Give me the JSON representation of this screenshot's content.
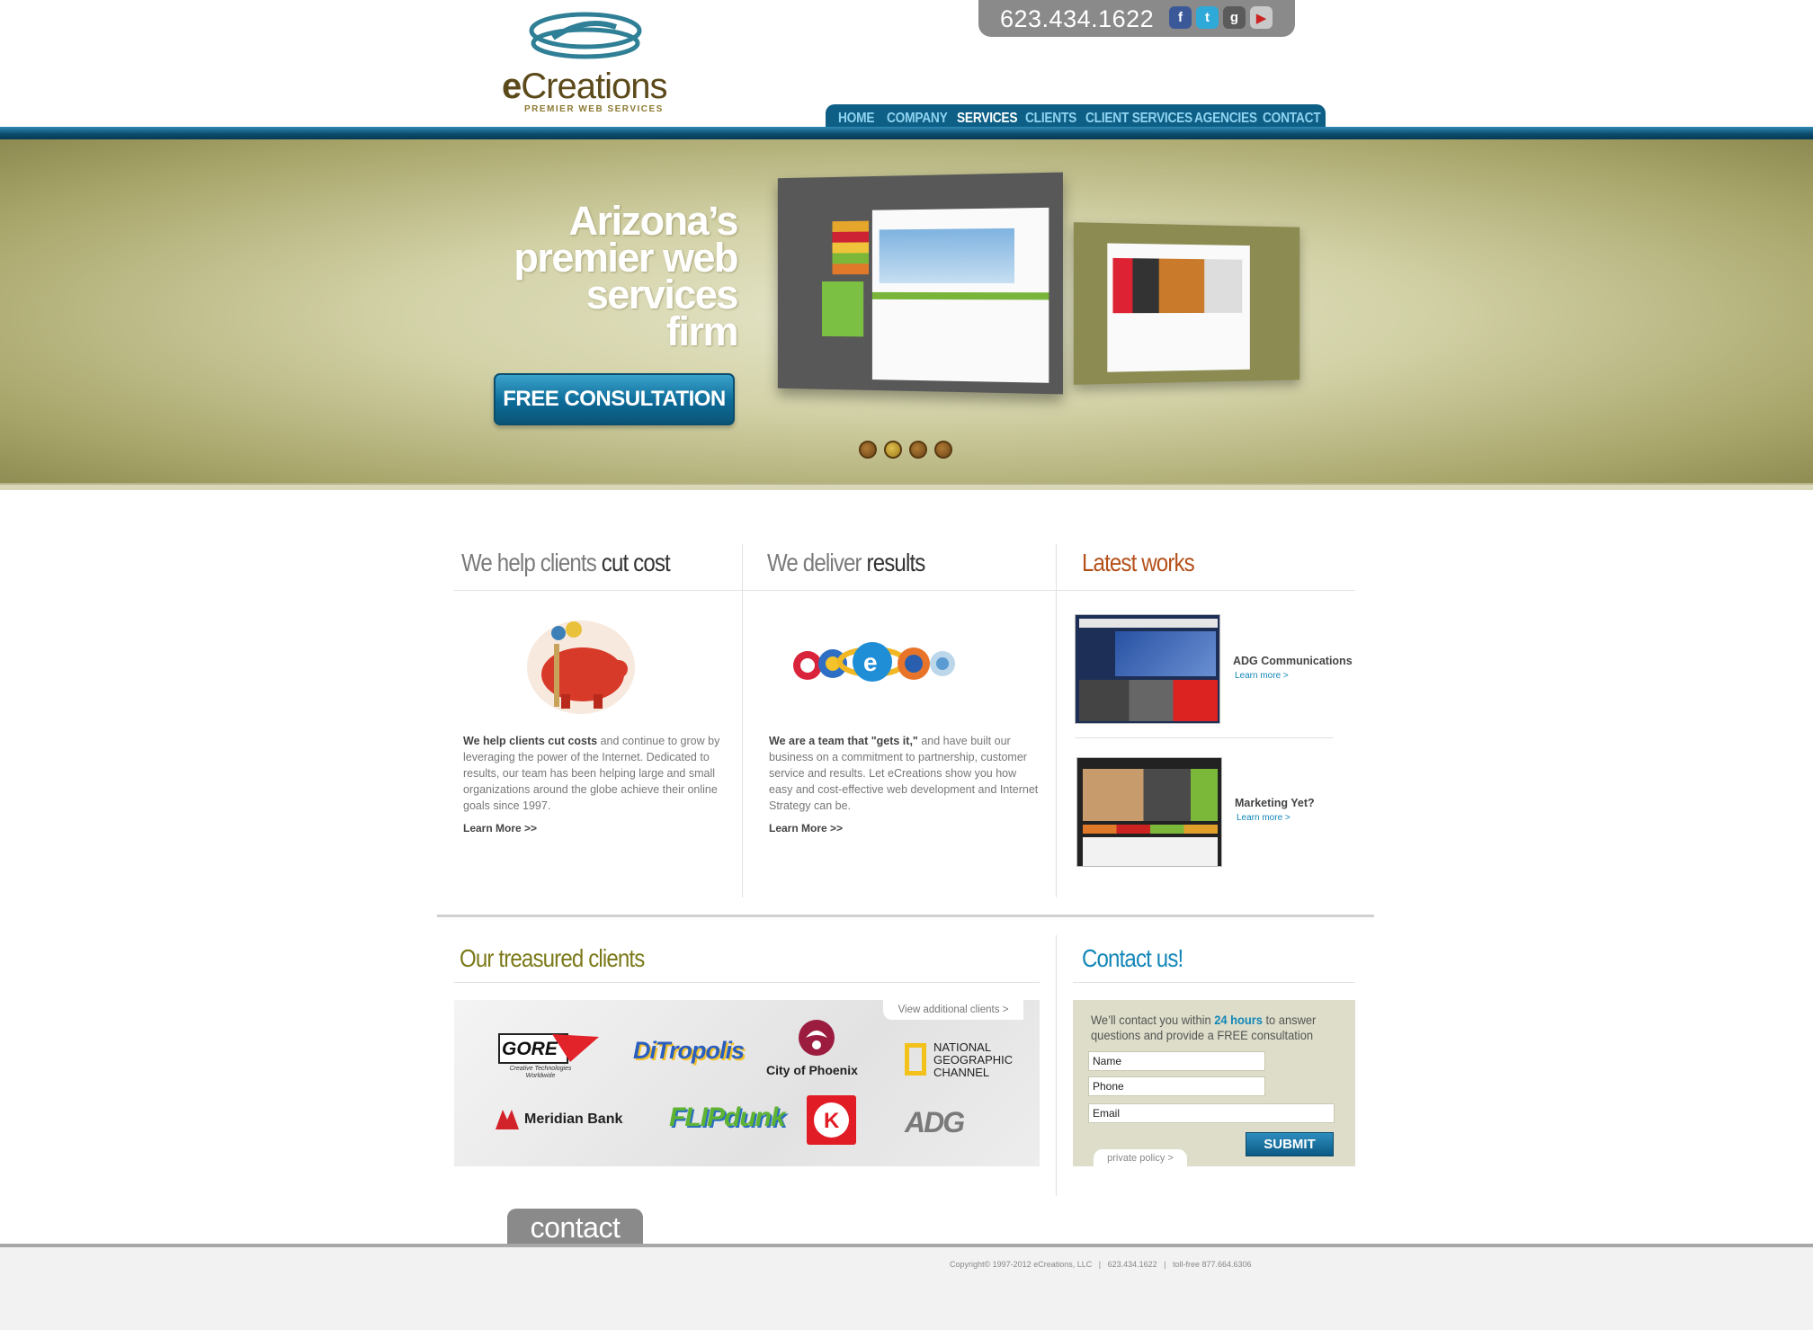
{
  "header": {
    "logo_text_bold": "e",
    "logo_text": "Creations",
    "logo_tagline": "PREMIER WEB SERVICES",
    "phone": "623.434.1622",
    "social": [
      "facebook-icon",
      "twitter-icon",
      "google-plus-icon",
      "youtube-icon"
    ]
  },
  "nav": {
    "items": [
      {
        "label": "HOME"
      },
      {
        "label": "COMPANY"
      },
      {
        "label": "SERVICES"
      },
      {
        "label": "CLIENTS"
      },
      {
        "label": "CLIENT SERVICES"
      },
      {
        "label": "AGENCIES"
      },
      {
        "label": "CONTACT"
      }
    ],
    "active": "SERVICES"
  },
  "hero": {
    "title_lines": [
      "Arizona’s",
      "premier web",
      "services",
      "firm"
    ],
    "cta": "FREE CONSULTATION",
    "slides": 4,
    "active_slide": 2
  },
  "col1": {
    "heading_light": "We help clients",
    "heading_dark": "cut cost",
    "lead": "We help clients cut costs",
    "body": " and continue to grow by leveraging the power of the Internet. Dedicated to results, our team has been helping large and small organizations around the globe achieve their online goals since 1997.",
    "learn_more": "Learn More >>"
  },
  "col2": {
    "heading_light": "We deliver",
    "heading_dark": "results",
    "lead": "We are a team that \"gets it,\"",
    "body": " and have built our business on a commitment to partnership, customer service and results. Let eCreations show you how easy and cost-effective web development and Internet Strategy can be.",
    "learn_more": "Learn More >>"
  },
  "latest": {
    "heading": "Latest works",
    "items": [
      {
        "title": "ADG Communications",
        "link": "Learn more >"
      },
      {
        "title": "Marketing Yet?",
        "link": "Learn more >"
      }
    ]
  },
  "clients": {
    "heading": "Our treasured clients",
    "view_more": "View additional clients >",
    "logos": [
      "GORE",
      "Creative Technologies Worldwide",
      "DiTropolis",
      "City of Phoenix",
      "NATIONAL GEOGRAPHIC CHANNEL",
      "Meridian Bank",
      "FLIPdunk",
      "ADG"
    ]
  },
  "contact": {
    "heading": "Contact us!",
    "intro_a": "We’ll contact you within ",
    "intro_b": "24 hours",
    "intro_c": " to answer questions and provide a FREE consultation",
    "name_placeholder": "Name",
    "phone_placeholder": "Phone",
    "email_placeholder": "Email",
    "submit": "SUBMIT",
    "privacy": "private policy >"
  },
  "footer": {
    "tab": "contact",
    "text": "Copyright© 1997-2012 eCreations, LLC   |   623.434.1622   |   toll-free 877.664.6306"
  },
  "colors": {
    "accent": "#0e5f86",
    "orange": "#b4501a",
    "olive": "#7b7a1a",
    "blue": "#1386b8"
  }
}
